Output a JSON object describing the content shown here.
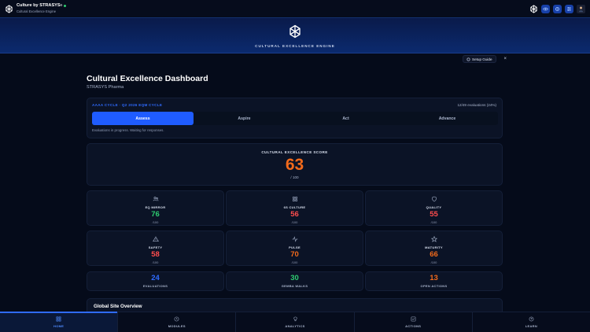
{
  "app": {
    "name": "Culture by STRASYS",
    "trademark": "®",
    "subtitle": "Cultural Excellence Engine"
  },
  "banner": {
    "title": "CULTURAL EXCELLENCE ENGINE"
  },
  "setup": {
    "label": "Setup Guide",
    "close": "×"
  },
  "dashboard": {
    "title": "Cultural Excellence Dashboard",
    "organization": "STRASYS Pharma"
  },
  "cycle": {
    "label": "AAAA CYCLE · Q2 2026 EQM CYCLE",
    "evaluations": "12/49 evaluations (24%)",
    "tabs": [
      {
        "label": "Assess",
        "active": true
      },
      {
        "label": "Aspire",
        "active": false
      },
      {
        "label": "Act",
        "active": false
      },
      {
        "label": "Advance",
        "active": false
      }
    ],
    "status": "Evaluations in progress. Waiting for responses."
  },
  "score": {
    "label": "CULTURAL EXCELLENCE SCORE",
    "value": "63",
    "max": "/ 100",
    "color": "#f26a1b"
  },
  "metrics": [
    {
      "label": "EQ MIRROR",
      "value": "76",
      "max": "/100",
      "icon": "users-icon",
      "color": "#2ecc71"
    },
    {
      "label": "6S CULTURE",
      "value": "56",
      "max": "/100",
      "icon": "grid-icon",
      "color": "#ff4d4d"
    },
    {
      "label": "QUALITY",
      "value": "55",
      "max": "/100",
      "icon": "shield-icon",
      "color": "#ff4d4d"
    },
    {
      "label": "SAFETY",
      "value": "58",
      "max": "/100",
      "icon": "warning-icon",
      "color": "#ff4d4d"
    },
    {
      "label": "PULSE",
      "value": "70",
      "max": "/100",
      "icon": "pulse-icon",
      "color": "#f26a1b"
    },
    {
      "label": "MATURITY",
      "value": "66",
      "max": "/100",
      "icon": "star-icon",
      "color": "#f26a1b"
    }
  ],
  "stats": [
    {
      "label": "EVALUATIONS",
      "value": "24",
      "color": "#2f6bff"
    },
    {
      "label": "GEMBA WALKS",
      "value": "30",
      "color": "#2ecc71"
    },
    {
      "label": "OPEN ACTIONS",
      "value": "13",
      "color": "#f26a1b"
    }
  ],
  "overview": {
    "title": "Global Site Overview"
  },
  "nav": [
    {
      "label": "HOME",
      "icon": "home-grid-icon",
      "active": true
    },
    {
      "label": "MODULES",
      "icon": "modules-icon",
      "active": false
    },
    {
      "label": "ANALYTICS",
      "icon": "lightbulb-icon",
      "active": false
    },
    {
      "label": "ACTIONS",
      "icon": "checkbox-icon",
      "active": false
    },
    {
      "label": "LEARN",
      "icon": "help-icon",
      "active": false
    }
  ]
}
